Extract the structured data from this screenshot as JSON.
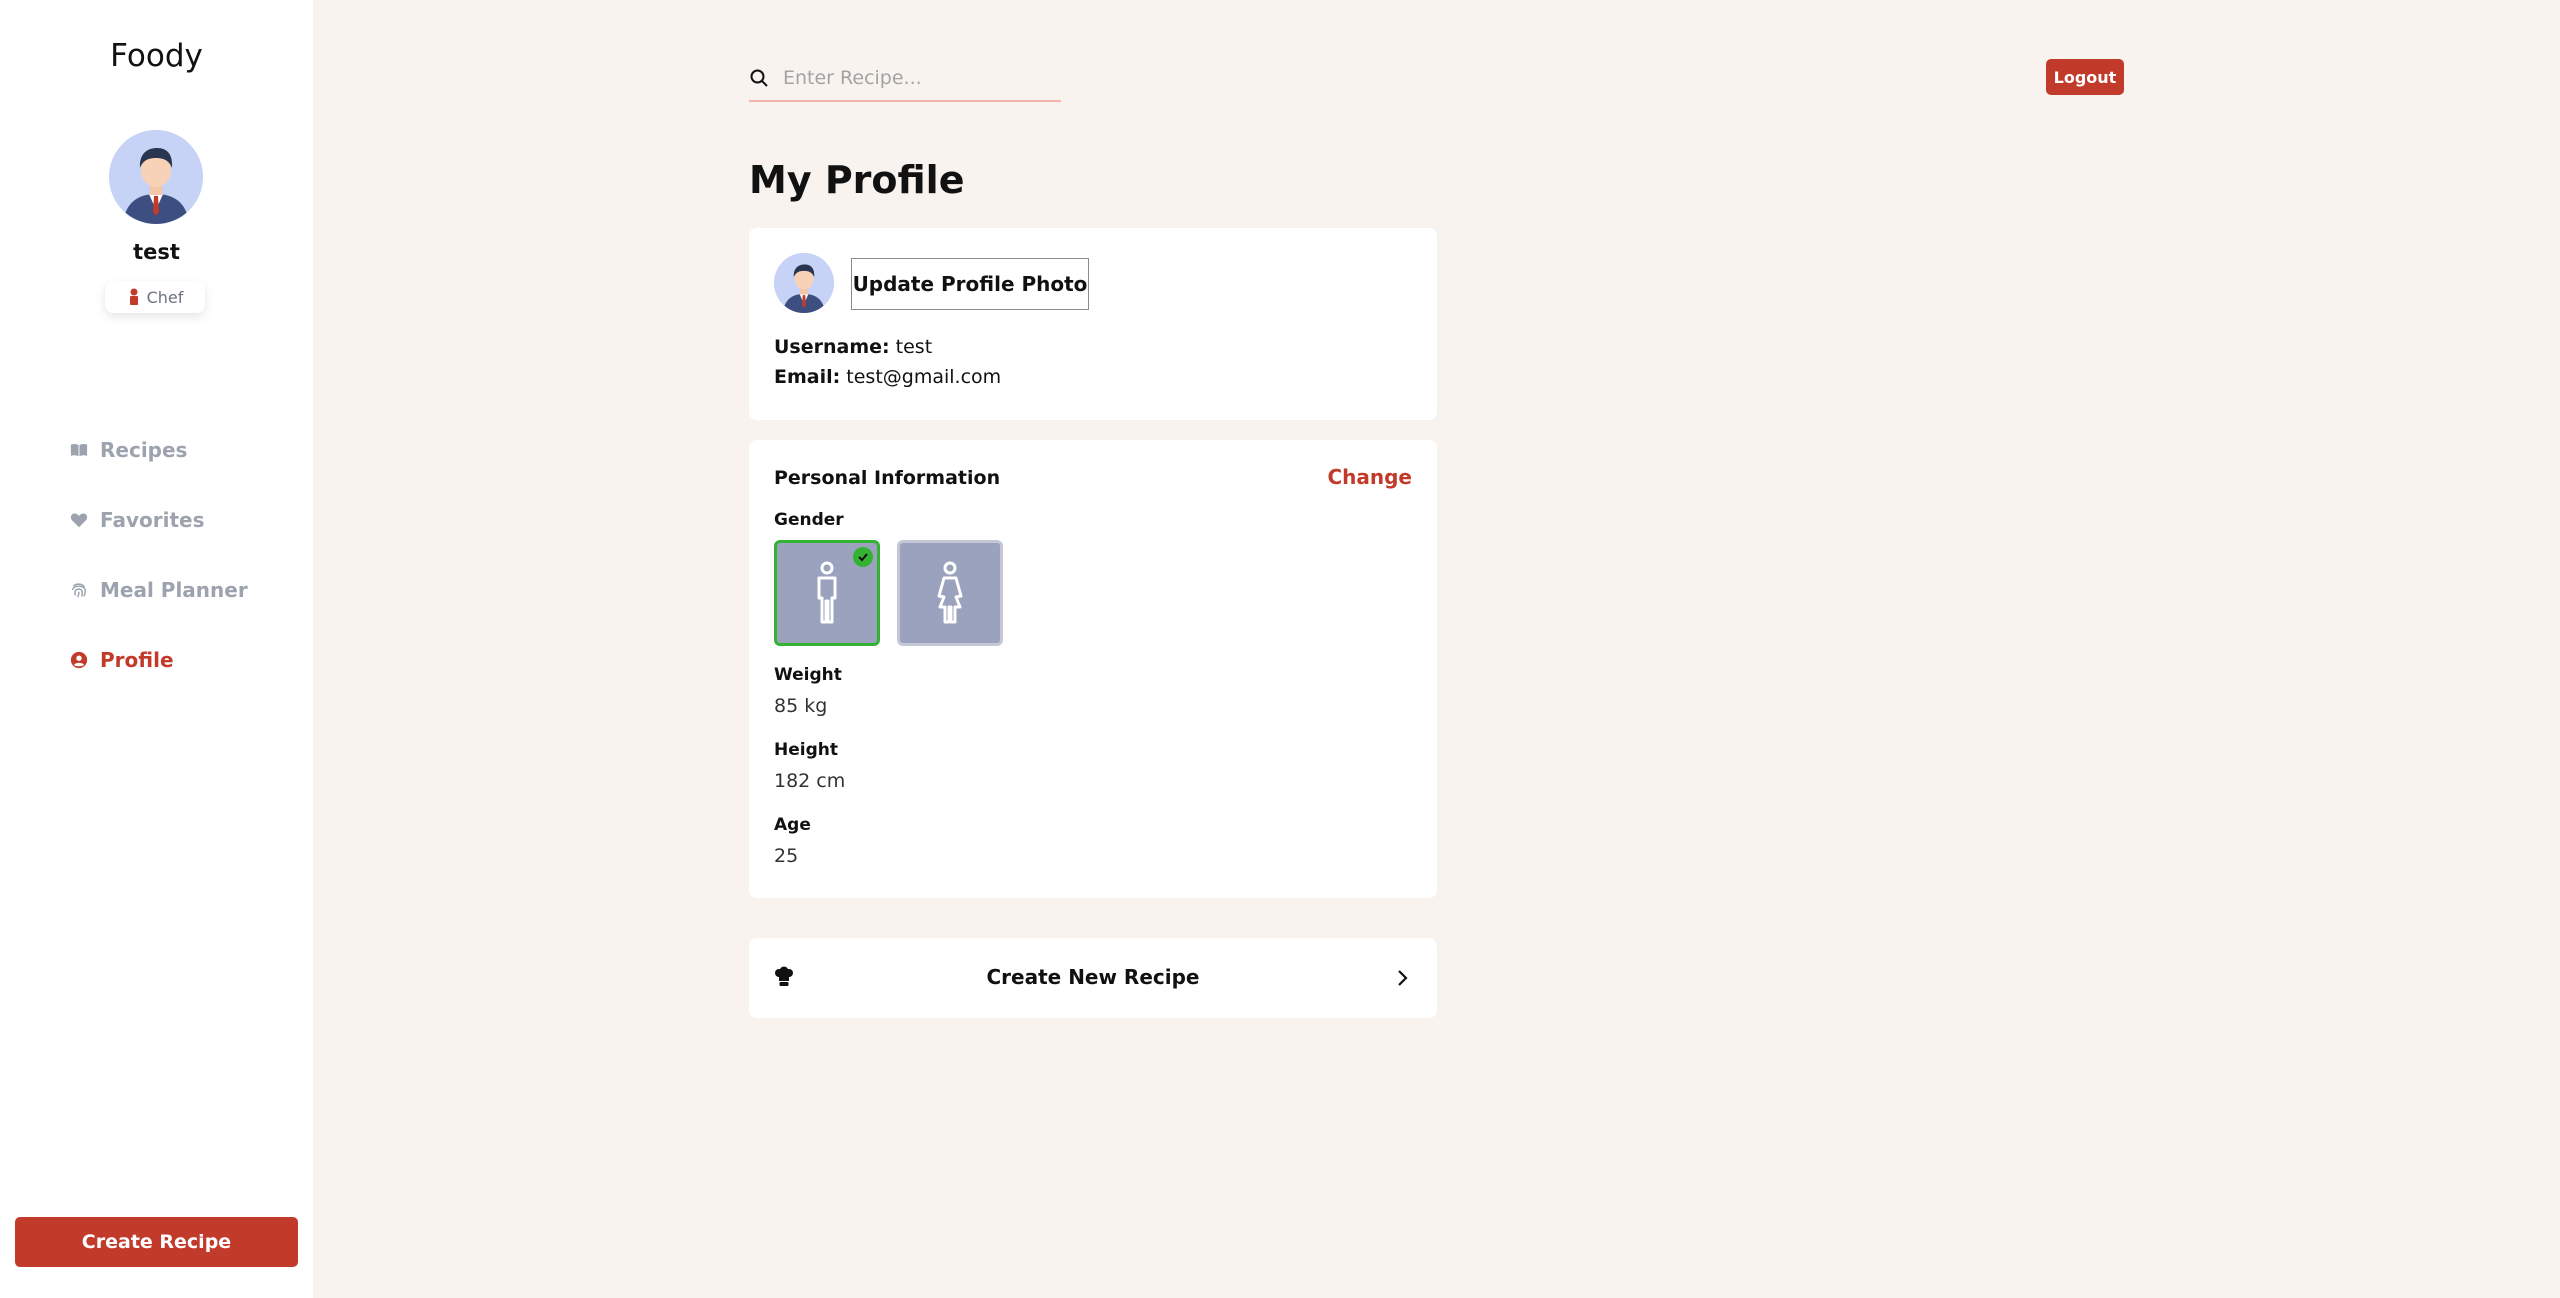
{
  "sidebar": {
    "brand": "Foody",
    "user_name": "test",
    "role": "Chef",
    "items": [
      {
        "label": "Recipes",
        "icon": "book-icon"
      },
      {
        "label": "Favorites",
        "icon": "heart-icon"
      },
      {
        "label": "Meal Planner",
        "icon": "fingerprint-icon"
      },
      {
        "label": "Profile",
        "icon": "user-circle-icon",
        "active": true
      }
    ],
    "create_button": "Create Recipe"
  },
  "header": {
    "search_placeholder": "Enter Recipe...",
    "logout_label": "Logout"
  },
  "main": {
    "title": "My Profile",
    "profile_card": {
      "update_photo_label": "Update Profile Photo",
      "username_label": "Username:",
      "username_value": "test",
      "email_label": "Email:",
      "email_value": "test@gmail.com"
    },
    "personal_info": {
      "title": "Personal Information",
      "change_label": "Change",
      "gender_label": "Gender",
      "gender_selected": "male",
      "weight_label": "Weight",
      "weight_value": "85 kg",
      "height_label": "Height",
      "height_value": "182 cm",
      "age_label": "Age",
      "age_value": "25"
    },
    "create_new_recipe_label": "Create New Recipe"
  },
  "colors": {
    "accent": "#c23a2a",
    "background": "#f8f3ef",
    "selected_border": "#34b233",
    "gender_tile": "#9aa2bd"
  }
}
